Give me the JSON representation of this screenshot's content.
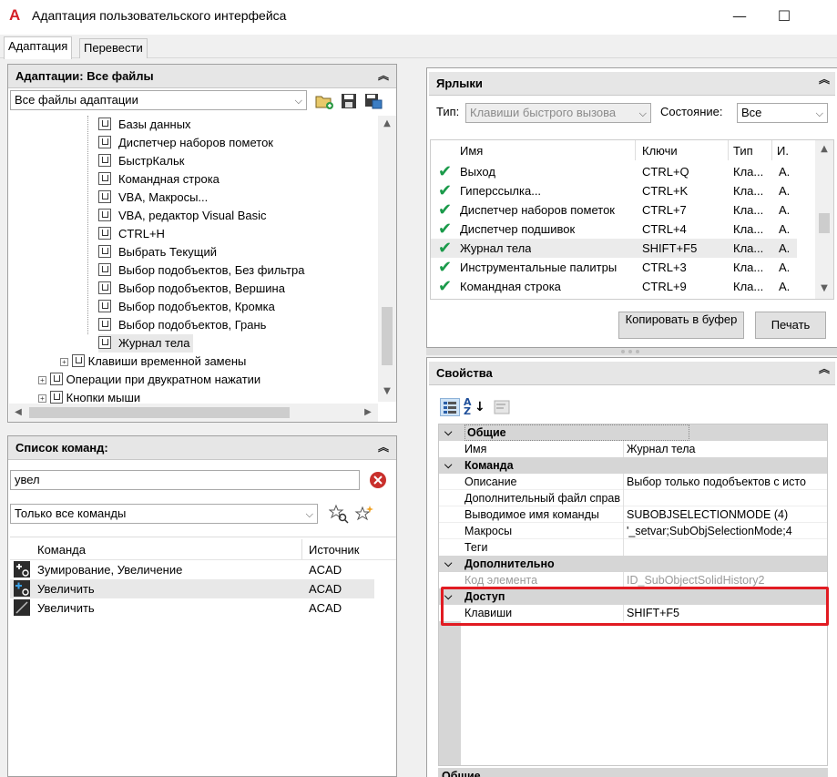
{
  "window": {
    "title": "Адаптация пользовательского интерфейса",
    "minimize": "—",
    "maximize": "☐",
    "close": "✕"
  },
  "tabs": [
    {
      "label": "Адаптация"
    },
    {
      "label": "Перевести"
    }
  ],
  "customizations": {
    "header": "Адаптации: Все файлы",
    "filter_value": "Все файлы адаптации",
    "tree": [
      "Базы данных",
      "Диспетчер наборов пометок",
      "БыстрКальк",
      "Командная строка",
      "VBA, Макросы...",
      "VBA, редактор Visual Basic",
      "CTRL+H",
      "Выбрать Текущий",
      "Выбор подобъектов, Без фильтра",
      "Выбор подобъектов, Вершина",
      "Выбор подобъектов, Кромка",
      "Выбор подобъектов, Грань",
      "Журнал тела"
    ],
    "tree_groups": [
      "Клавиши временной замены",
      "Операции при двукратном нажатии",
      "Кнопки мыши"
    ]
  },
  "command_list": {
    "header": "Список команд:",
    "search_value": "увел",
    "filter_value": "Только все команды",
    "columns": [
      "Команда",
      "Источник"
    ],
    "rows": [
      {
        "name": "Зумирование, Увеличение",
        "source": "ACAD"
      },
      {
        "name": "Увеличить",
        "source": "ACAD"
      },
      {
        "name": "Увеличить",
        "source": "ACAD"
      }
    ]
  },
  "shortcuts": {
    "header": "Ярлыки",
    "type_label": "Тип:",
    "type_value": "Клавиши быстрого вызова",
    "state_label": "Состояние:",
    "state_value": "Все",
    "columns": [
      "Имя",
      "Ключи",
      "Тип",
      "И."
    ],
    "rows": [
      {
        "name": "Выход",
        "keys": "CTRL+Q",
        "type": "Кла...",
        "i": "A."
      },
      {
        "name": "Гиперссылка...",
        "keys": "CTRL+K",
        "type": "Кла...",
        "i": "A."
      },
      {
        "name": "Диспетчер наборов пометок",
        "keys": "CTRL+7",
        "type": "Кла...",
        "i": "A."
      },
      {
        "name": "Диспетчер подшивок",
        "keys": "CTRL+4",
        "type": "Кла...",
        "i": "A."
      },
      {
        "name": "Журнал тела",
        "keys": "SHIFT+F5",
        "type": "Кла...",
        "i": "A."
      },
      {
        "name": "Инструментальные палитры",
        "keys": "CTRL+3",
        "type": "Кла...",
        "i": "A."
      },
      {
        "name": "Командная строка",
        "keys": "CTRL+9",
        "type": "Кла...",
        "i": "A."
      }
    ],
    "copy_button": "Копировать в буфер",
    "print_button": "Печать"
  },
  "properties": {
    "header": "Свойства",
    "sections": [
      {
        "title": "Общие",
        "rows": [
          {
            "k": "Имя",
            "v": "Журнал тела"
          }
        ]
      },
      {
        "title": "Команда",
        "rows": [
          {
            "k": "Описание",
            "v": "Выбор только подобъектов с исто"
          },
          {
            "k": "Дополнительный файл справ",
            "v": ""
          },
          {
            "k": "Выводимое имя команды",
            "v": "SUBOBJSELECTIONMODE (4)"
          },
          {
            "k": "Макросы",
            "v": "'_setvar;SubObjSelectionMode;4"
          },
          {
            "k": "Теги",
            "v": ""
          }
        ]
      },
      {
        "title": "Дополнительно",
        "rows": [
          {
            "k": "Код элемента",
            "v": "ID_SubObjectSolidHistory2"
          }
        ]
      },
      {
        "title": "Доступ",
        "rows": [
          {
            "k": "Клавиши",
            "v": "SHIFT+F5"
          }
        ]
      }
    ],
    "footer_title": "Общие"
  },
  "colors": {
    "highlight": "#e11b22",
    "check": "#1a9a4a",
    "accent": "#d42027"
  }
}
